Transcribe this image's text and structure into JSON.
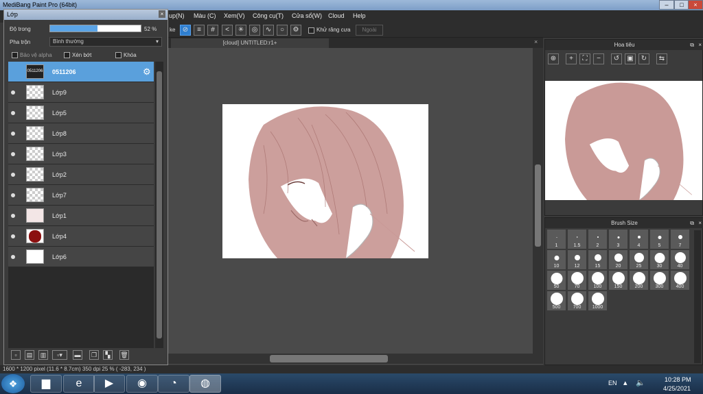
{
  "app": {
    "title": "MediBang Paint Pro (64bit)",
    "min": "–",
    "max": "□",
    "close": "×"
  },
  "menu": [
    "up(N)",
    "Màu (C)",
    "Xem(V)",
    "Công cụ(T)",
    "Cửa sổ(W)",
    "Cloud",
    "Help"
  ],
  "toolbar": {
    "left_label": "ke",
    "antialias_label": "Khử răng cưa",
    "extra_label": "Ngoài"
  },
  "canvas": {
    "tab_label": "[cloud] UNTITLED:r1+"
  },
  "layer_panel": {
    "title": "Lớp",
    "opacity_label": "Độ trong",
    "opacity_value": "52 %",
    "opacity_fraction": 0.52,
    "blend_label": "Pha trộn",
    "blend_value": "Bình thường",
    "protect_alpha": "Bảo vệ alpha",
    "clipping": "Xén bớt",
    "lock": "Khóa",
    "layers": [
      {
        "name": "0511206",
        "selected": true,
        "thumb": "text"
      },
      {
        "name": "Lớp9"
      },
      {
        "name": "Lớp5"
      },
      {
        "name": "Lớp8"
      },
      {
        "name": "Lớp3"
      },
      {
        "name": "Lớp2"
      },
      {
        "name": "Lớp7"
      },
      {
        "name": "Lớp1"
      },
      {
        "name": "Lớp4",
        "thumb": "red"
      },
      {
        "name": "Lớp6",
        "thumb": "white"
      }
    ],
    "thumb_text": "0511206"
  },
  "navigator": {
    "title": "Hoa tiêu"
  },
  "brush_size": {
    "title": "Brush Size",
    "sizes": [
      "1",
      "1.5",
      "2",
      "3",
      "4",
      "5",
      "7",
      "10",
      "12",
      "15",
      "20",
      "25",
      "30",
      "40",
      "50",
      "70",
      "100",
      "150",
      "200",
      "300",
      "400",
      "500",
      "700",
      "1000"
    ]
  },
  "status": {
    "text": "1600 * 1200 pixel  (11.6 * 8.7cm)  350 dpi  25 %  ( -283, 234 )"
  },
  "taskbar": {
    "lang": "EN",
    "time": "10:28 PM",
    "date": "4/25/2021"
  },
  "colors": {
    "accent": "#2f7fd0",
    "hair": "#c99a97",
    "layer_selected": "#5aa0dc"
  }
}
